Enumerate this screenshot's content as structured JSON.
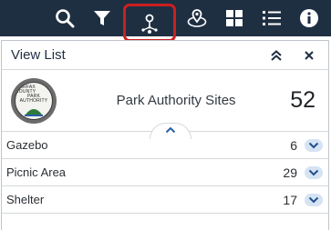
{
  "toolbar": {
    "items": [
      {
        "icon": "search-icon"
      },
      {
        "icon": "filter-icon"
      },
      {
        "icon": "location-network-icon",
        "active": true,
        "highlighted": true
      },
      {
        "icon": "location-radius-icon"
      },
      {
        "icon": "grid-icon"
      },
      {
        "icon": "list-icon"
      },
      {
        "icon": "info-icon"
      }
    ],
    "background": "#1f2f42",
    "highlight_color": "#cc1f1f"
  },
  "panel": {
    "title": "View List",
    "collapse_icon": "double-chevron-up-icon",
    "close_icon": "close-icon"
  },
  "summary": {
    "logo_text": [
      "FAIRFAX COUNTY",
      "PARK",
      "AUTHORITY"
    ],
    "label": "Park Authority Sites",
    "count": "52"
  },
  "items": [
    {
      "label": "Gazebo",
      "count": "6"
    },
    {
      "label": "Picnic Area",
      "count": "29"
    },
    {
      "label": "Shelter",
      "count": "17"
    }
  ]
}
